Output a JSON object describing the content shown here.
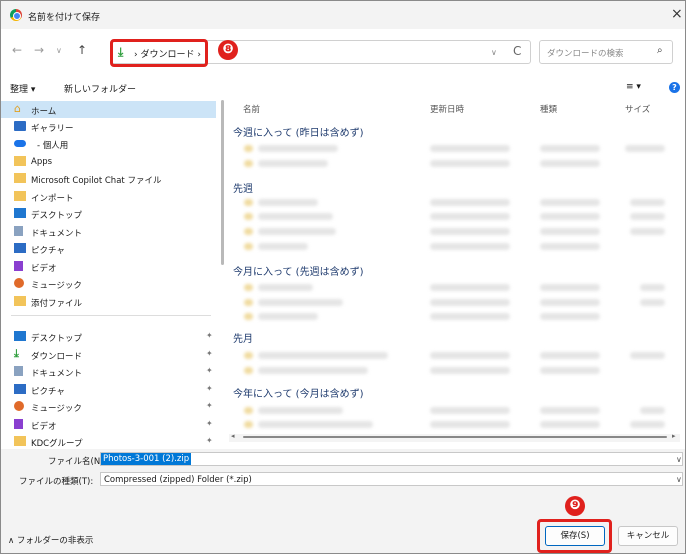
{
  "window": {
    "title": "名前を付けて保存"
  },
  "nav": {
    "back": "←",
    "forward": "→",
    "recent": "∨",
    "up": "↑",
    "breadcrumb": "› ダウンロード ›",
    "addr_dropdown": "∨",
    "refresh": "C",
    "search_placeholder": "ダウンロードの検索",
    "step_badge": "❽"
  },
  "toolbar": {
    "organize": "整理 ▾",
    "new_folder": "新しいフォルダー",
    "view": "≡ ▾",
    "help": "?"
  },
  "sidebar": {
    "items": [
      {
        "label": "ホーム",
        "icon": "home-icon"
      },
      {
        "label": "ギャラリー",
        "icon": "gallery-icon"
      },
      {
        "label": "- 個人用",
        "icon": "onedrive-icon"
      },
      {
        "label": "Apps",
        "icon": "folder-icon"
      },
      {
        "label": "Microsoft Copilot Chat ファイル",
        "icon": "folder-icon"
      },
      {
        "label": "インポート",
        "icon": "folder-icon"
      },
      {
        "label": "デスクトップ",
        "icon": "desktop-icon"
      },
      {
        "label": "ドキュメント",
        "icon": "document-icon"
      },
      {
        "label": "ピクチャ",
        "icon": "pictures-icon"
      },
      {
        "label": "ビデオ",
        "icon": "video-icon"
      },
      {
        "label": "ミュージック",
        "icon": "music-icon"
      },
      {
        "label": "添付ファイル",
        "icon": "folder-icon"
      }
    ],
    "quick": [
      {
        "label": "デスクトップ",
        "icon": "desktop-icon"
      },
      {
        "label": "ダウンロード",
        "icon": "download-icon"
      },
      {
        "label": "ドキュメント",
        "icon": "document-icon"
      },
      {
        "label": "ピクチャ",
        "icon": "pictures-icon"
      },
      {
        "label": "ミュージック",
        "icon": "music-icon"
      },
      {
        "label": "ビデオ",
        "icon": "video-icon"
      },
      {
        "label": "KDCグループ",
        "icon": "folder-icon"
      }
    ],
    "pin": "📌"
  },
  "columns": {
    "name": "名前",
    "date": "更新日時",
    "type": "種類",
    "size": "サイズ"
  },
  "groups": [
    "今週に入って (昨日は含めず)",
    "先週",
    "今月に入って (先週は含めず)",
    "先月",
    "今年に入って (今月は含めず)"
  ],
  "fields": {
    "filename_label": "ファイル名(N):",
    "filename_value": "Photos-3-001 (2).zip",
    "filetype_label": "ファイルの種類(T):",
    "filetype_value": "Compressed (zipped) Folder (*.zip)"
  },
  "footer": {
    "hide_folders": "∧ フォルダーの非表示",
    "save": "保存(S)",
    "cancel": "キャンセル",
    "step_badge": "❾"
  },
  "colors": {
    "highlight": "#e0211d",
    "accent": "#0078d7",
    "selected": "#cce4f7"
  }
}
